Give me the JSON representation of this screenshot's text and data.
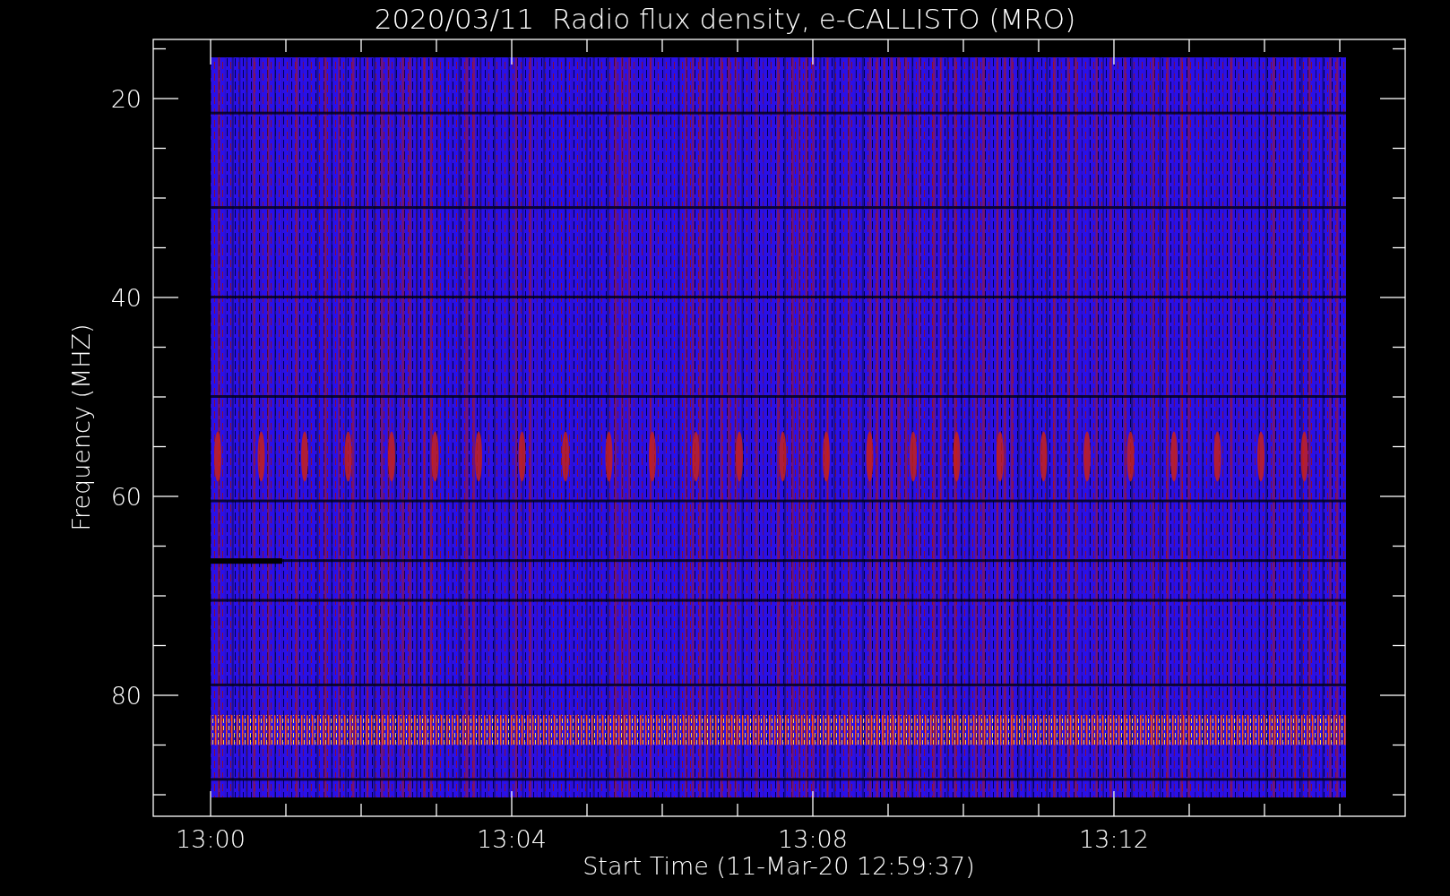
{
  "title": "2020/03/11  Radio flux density, e-CALLISTO (MRO)",
  "y_axis": {
    "label": "Frequency (MHZ)",
    "ticks": [
      "20",
      "40",
      "60",
      "80"
    ]
  },
  "x_axis": {
    "label": "Start Time (11-Mar-20 12:59:37)",
    "ticks": [
      "13:00",
      "13:04",
      "13:08",
      "13:12"
    ]
  }
}
